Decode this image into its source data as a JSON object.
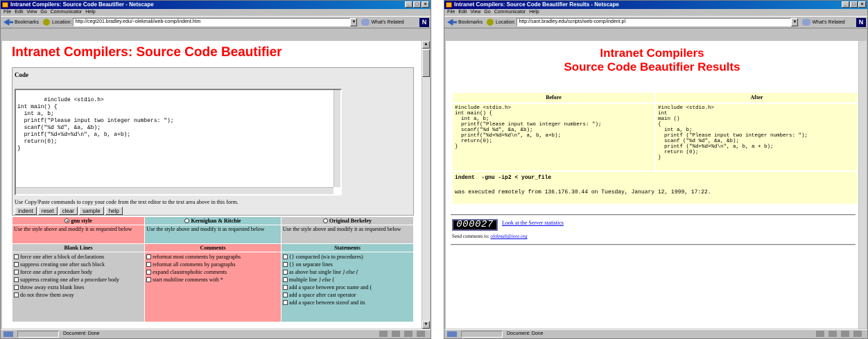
{
  "window1": {
    "title": "Intranet Compilers: Source Code Beautifier - Netscape",
    "menu": [
      "File",
      "Edit",
      "View",
      "Go",
      "Communicator",
      "Help"
    ],
    "bookmarks_label": "Bookmarks",
    "location_label": "Location:",
    "location_url": "http://cegt201.bradley.edu/~olekmali/web-comp/indent.htm",
    "related_label": "What's Related",
    "page_title": "Intranet Compilers: Source Code Beautifier",
    "code_label": "Code",
    "code_text": "#include <stdio.h>\nint main() {\n  int a, b;\n  printf(\"Please input two integer numbers: \");\n  scanf(\"%d %d\", &a, &b);\n  printf(\"%d+%d=%d\\n\", a, b, a+b);\n  return(0);\n}",
    "hint": "Use Copy/Paste commands to copy your code from the text editor to the text area above in this form.",
    "buttons": [
      "indent",
      "reset",
      "clear",
      "sample",
      "help"
    ],
    "styles": [
      {
        "label": "gnu style",
        "selected": true,
        "desc": "Use the style above and modify it as requested below"
      },
      {
        "label": "Kernighan & Ritchie",
        "selected": false,
        "desc": "Use the style above and modify it as requested below"
      },
      {
        "label": "Original Berkeley",
        "selected": false,
        "desc": "Use the style above and modify it as requested below"
      }
    ],
    "blank_lines": {
      "header": "Blank Lines",
      "items": [
        "force one after a block of declarations",
        "suppress creating one after such block",
        "force one after a procedure body",
        "suppress creating one after a procedure body",
        "throw away extra blank lines",
        "do not throw them away"
      ]
    },
    "comments": {
      "header": "Comments",
      "items": [
        "reformat most comments by paragraphs",
        "reformat all comments by paragraphs",
        "expand claustrophobic comments",
        "start multiline comments with *"
      ]
    },
    "statements": {
      "header": "Statements",
      "items": [
        {
          "text": "{} compacted (n/a to procedures)",
          "em": ""
        },
        {
          "text": "{} on separate lines",
          "em": ""
        },
        {
          "text": "as above but single line ",
          "em": "} else {"
        },
        {
          "text": "multiple line ",
          "em": "} else {"
        },
        {
          "text": "add a space between proc name and (",
          "em": ""
        },
        {
          "text": "add a space after cast operator",
          "em": ""
        },
        {
          "text": "add a space between sizeof and its",
          "em": ""
        }
      ]
    },
    "status": "Document: Done"
  },
  "window2": {
    "title": "Intranet Compilers: Source Code Beautifier Results - Netscape",
    "menu": [
      "File",
      "Edit",
      "View",
      "Go",
      "Communicator",
      "Help"
    ],
    "bookmarks_label": "Bookmarks",
    "location_label": "Location:",
    "location_url": "http://sant.bradley.edu/scripts/web-comp/indent.pl",
    "related_label": "What's Related",
    "title_line1": "Intranet Compilers",
    "title_line2": "Source Code Beautifier Results",
    "before_header": "Before",
    "after_header": "After",
    "before_code": "#include <stdio.h>\nint main() {\n  int a, b;\n  printf(\"Please input two integer numbers: \");\n  scanf(\"%d %d\", &a, &b);\n  printf(\"%d+%d=%d\\n\", a, b, a+b);\n  return(0);\n}",
    "after_code": "#include <stdio.h>\nint\nmain ()\n{\n  int a, b;\n  printf (\"Please input two integer numbers: \");\n  scanf (\"%d %d\", &a, &b);\n  printf (\"%d+%d=%d\\n\", a, b, a + b);\n  return (0);\n}",
    "command": "indent  -gnu -ip2 < your_file",
    "executed": "was executed remotely from 136.176.30.44 on Tuesday, January 12, 1999, 17:22.",
    "counter": "000027",
    "stats_link": "Look at the Server statistics",
    "send_comments": "Send comments to: ",
    "email": "olekmali@ieee.org",
    "status": "Document: Done"
  },
  "colors": {
    "title_red": "#ff0000",
    "pink": "#ff9999",
    "teal": "#99cccc",
    "yellow": "#ffffcc",
    "titlebar": "#000080"
  }
}
